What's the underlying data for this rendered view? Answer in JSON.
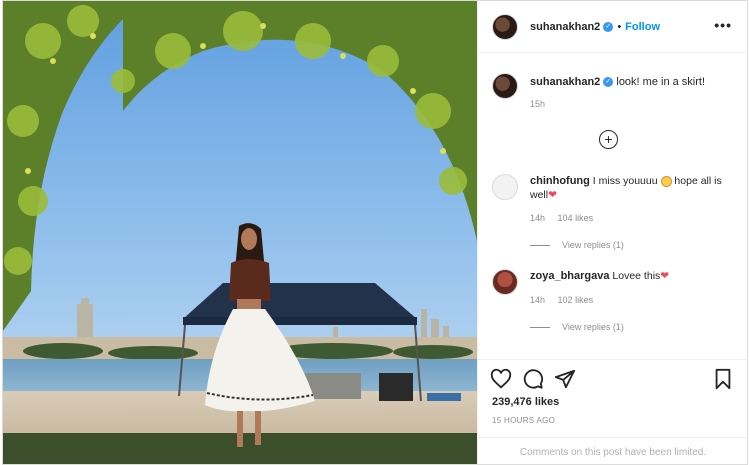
{
  "post": {
    "username": "suhanakhan2",
    "follow_label": "Follow",
    "more_label": "•••",
    "separator": "•"
  },
  "caption": {
    "username": "suhanakhan2",
    "text": "look! me in a skirt!",
    "time": "15h"
  },
  "load_more_label": "+",
  "comments": [
    {
      "username": "chinhofung",
      "text": "I miss youuuu",
      "text_after_emoji": "hope all is well",
      "heart": "❤",
      "time": "14h",
      "likes": "104 likes",
      "replies": "View replies (1)"
    },
    {
      "username": "zoya_bhargava",
      "text": "Lovee this",
      "heart": "❤",
      "time": "14h",
      "likes": "102 likes",
      "replies": "View replies (1)"
    }
  ],
  "actions": {
    "likes": "239,476 likes",
    "posted": "15 HOURS AGO",
    "limited": "Comments on this post have been limited."
  },
  "icons": [
    "more-icon",
    "verified-icon",
    "heart-icon",
    "comment-icon",
    "share-icon",
    "save-icon",
    "load-more-icon"
  ],
  "colors": {
    "link": "#0095f6",
    "verified": "#3897f0",
    "heart": "#ed4956",
    "muted": "#8e8e8e"
  }
}
